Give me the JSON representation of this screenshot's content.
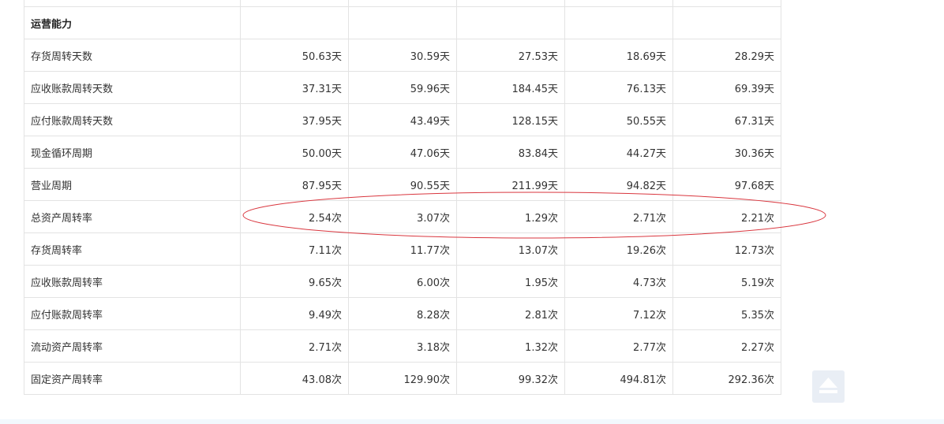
{
  "section_title": "运营能力",
  "rows": [
    {
      "label": "存货周转天数",
      "values": [
        "50.63天",
        "30.59天",
        "27.53天",
        "18.69天",
        "28.29天"
      ]
    },
    {
      "label": "应收账款周转天数",
      "values": [
        "37.31天",
        "59.96天",
        "184.45天",
        "76.13天",
        "69.39天"
      ]
    },
    {
      "label": "应付账款周转天数",
      "values": [
        "37.95天",
        "43.49天",
        "128.15天",
        "50.55天",
        "67.31天"
      ]
    },
    {
      "label": "现金循环周期",
      "values": [
        "50.00天",
        "47.06天",
        "83.84天",
        "44.27天",
        "30.36天"
      ]
    },
    {
      "label": "营业周期",
      "values": [
        "87.95天",
        "90.55天",
        "211.99天",
        "94.82天",
        "97.68天"
      ]
    },
    {
      "label": "总资产周转率",
      "values": [
        "2.54次",
        "3.07次",
        "1.29次",
        "2.71次",
        "2.21次"
      ]
    },
    {
      "label": "存货周转率",
      "values": [
        "7.11次",
        "11.77次",
        "13.07次",
        "19.26次",
        "12.73次"
      ]
    },
    {
      "label": "应收账款周转率",
      "values": [
        "9.65次",
        "6.00次",
        "1.95次",
        "4.73次",
        "5.19次"
      ]
    },
    {
      "label": "应付账款周转率",
      "values": [
        "9.49次",
        "8.28次",
        "2.81次",
        "7.12次",
        "5.35次"
      ]
    },
    {
      "label": "流动资产周转率",
      "values": [
        "2.71次",
        "3.18次",
        "1.32次",
        "2.77次",
        "2.27次"
      ]
    },
    {
      "label": "固定资产周转率",
      "values": [
        "43.08次",
        "129.90次",
        "99.32次",
        "494.81次",
        "292.36次"
      ]
    }
  ],
  "colors": {
    "annotation_ellipse": "#d9363e",
    "border": "#e3e3e3",
    "back_to_top_bg": "#e9eef5",
    "back_to_top_icon": "#ffffff"
  },
  "icons": {
    "back_to_top": "back-to-top-icon"
  }
}
